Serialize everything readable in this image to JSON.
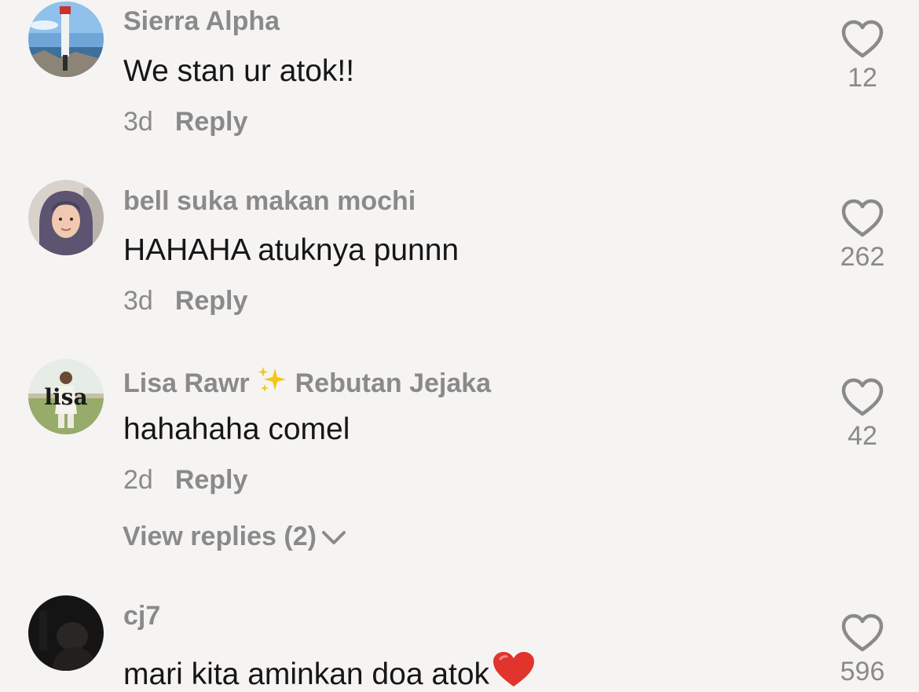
{
  "comments": [
    {
      "username": "Sierra Alpha",
      "text": "We stan ur atok!!",
      "time": "3d",
      "reply_label": "Reply",
      "likes": "12",
      "avatar_icon": "avatar-lighthouse-photo"
    },
    {
      "username": "bell suka makan mochi",
      "text": "HAHAHA atuknya punnn",
      "time": "3d",
      "reply_label": "Reply",
      "likes": "262",
      "avatar_icon": "avatar-hijab-portrait"
    },
    {
      "username_part1": "Lisa Rawr",
      "username_part2": "Rebutan Jejaka",
      "username_emoji": "sparkles-emoji",
      "text": "hahahaha comel",
      "time": "2d",
      "reply_label": "Reply",
      "likes": "42",
      "avatar_icon": "avatar-lisa-photo",
      "avatar_text": "lisa",
      "view_replies": "View replies (2)"
    },
    {
      "username": "cj7",
      "text": "mari kita aminkan doa atok",
      "text_emoji": "red-heart-emoji",
      "likes": "596",
      "avatar_icon": "avatar-dark-photo"
    }
  ],
  "colors": {
    "background": "#f5f4f2",
    "username": "#8a8a8a",
    "text": "#161616",
    "heart_outline": "#8a8a8a",
    "emoji_heart": "#e0342c"
  }
}
